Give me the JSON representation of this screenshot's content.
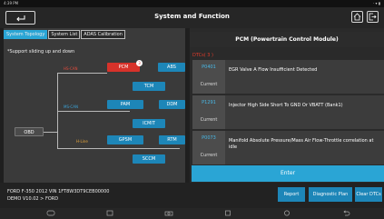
{
  "status_bar": {
    "time": "4:39 PM",
    "right": "· ▾ ▮"
  },
  "header": {
    "title": "System and Function"
  },
  "tabs": [
    {
      "label": "System Topology",
      "active": true
    },
    {
      "label": "System List",
      "active": false
    },
    {
      "label": "ADAS Calibration",
      "active": false
    }
  ],
  "topology": {
    "hint": "*Support sliding up and down",
    "badge": "3",
    "bus_labels": {
      "hs": "HS-CAN",
      "ms": "MS-CAN",
      "hcan": "H-Line"
    },
    "nodes": {
      "pcm": "PCM",
      "abs": "ABS",
      "tcm": "TCM",
      "pam": "PAM",
      "ddm": "DDM",
      "icmit": "ICMIT",
      "obd": "OBD",
      "gpsm": "GPSM",
      "rtm": "RTM",
      "sccm": "SCCM"
    }
  },
  "module_panel": {
    "title": "PCM (Powertrain Control Module)",
    "dtc_count": "DTCs( 3 )",
    "dtcs": [
      {
        "code": "P0401",
        "status": "Current",
        "desc": "EGR Valve A Flow Insufficient Detected"
      },
      {
        "code": "P1291",
        "status": "Current",
        "desc": "Injector High Side Short To GND Or VBATT (Bank1)"
      },
      {
        "code": "P0073",
        "status": "Current",
        "desc": "Manifold Absolute Pressure/Mass Air Flow-Throttle correlation at idle"
      }
    ],
    "enter_label": "Enter"
  },
  "vehicle": {
    "line1": "FORD  F-350  2012  VIN  1FT8W3DT9CEB00000",
    "line2": "DEMO V10.02 > FORD"
  },
  "actions": {
    "report": "Report",
    "diagnostic_plan": "Diagnostic Plan",
    "clear_dtcs": "Clear DTCs"
  },
  "colors": {
    "accent": "#2aa5d5",
    "module_blue": "#1d86b8",
    "selected_red": "#d7322a",
    "dtc_count_red": "#e03b2a"
  }
}
